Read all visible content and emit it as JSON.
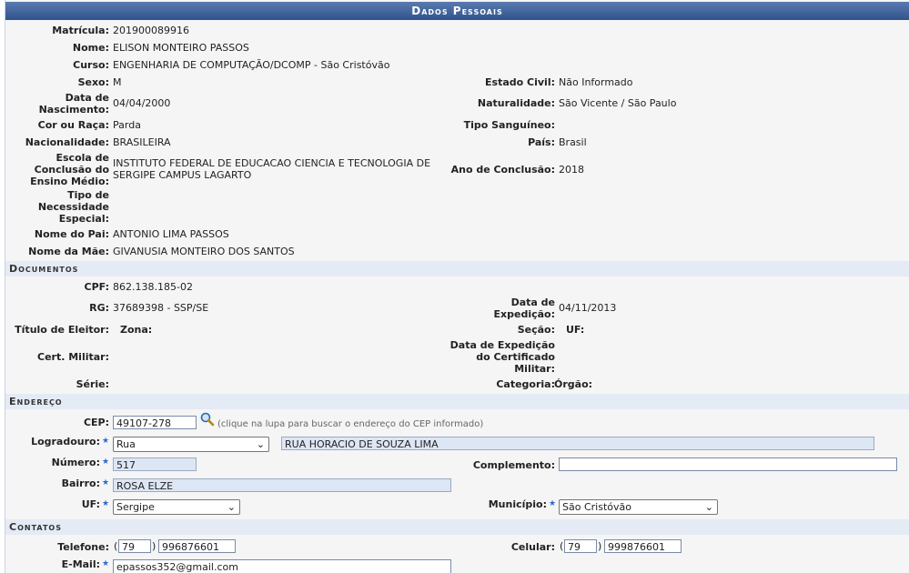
{
  "caption": "Dados Pessoais",
  "personal": {
    "matricula_label": "Matrícula:",
    "matricula": "201900089916",
    "nome_label": "Nome:",
    "nome": "ELISON MONTEIRO PASSOS",
    "curso_label": "Curso:",
    "curso": "ENGENHARIA DE COMPUTAÇÃO/DCOMP - São Cristóvão",
    "sexo_label": "Sexo:",
    "sexo": "M",
    "estado_civil_label": "Estado Civil:",
    "estado_civil": "Não Informado",
    "nascimento_label_1": "Data de",
    "nascimento_label_2": "Nascimento:",
    "nascimento": "04/04/2000",
    "naturalidade_label": "Naturalidade:",
    "naturalidade": "São Vicente / São Paulo",
    "cor_label": "Cor ou Raça:",
    "cor": "Parda",
    "sangue_label": "Tipo Sanguíneo:",
    "nacionalidade_label": "Nacionalidade:",
    "nacionalidade": "BRASILEIRA",
    "pais_label": "País:",
    "pais": "Brasil",
    "escola_label_1": "Escola de",
    "escola_label_2": "Conclusão do",
    "escola_label_3": "Ensino Médio:",
    "escola": "INSTITUTO FEDERAL DE EDUCACAO CIENCIA E TECNOLOGIA DE SERGIPE CAMPUS LAGARTO",
    "ano_conclusao_label": "Ano de Conclusão:",
    "ano_conclusao": "2018",
    "necessidade_label_1": "Tipo de",
    "necessidade_label_2": "Necessidade",
    "necessidade_label_3": "Especial:",
    "pai_label": "Nome do Pai:",
    "pai": "ANTONIO LIMA PASSOS",
    "mae_label": "Nome da Mãe:",
    "mae": "GIVANUSIA MONTEIRO DOS SANTOS"
  },
  "documentos": {
    "title": "Documentos",
    "cpf_label": "CPF:",
    "cpf": "862.138.185-02",
    "rg_label": "RG:",
    "rg": "37689398 - SSP/SE",
    "expedicao_label_1": "Data de",
    "expedicao_label_2": "Expedição:",
    "expedicao": "04/11/2013",
    "titulo_label": "Título de Eleitor:",
    "zona_label": "Zona:",
    "secao_label": "Seção:",
    "uf_label": "UF:",
    "militar_label": "Cert. Militar:",
    "exp_militar_label_1": "Data de Expedição",
    "exp_militar_label_2": "do Certificado",
    "exp_militar_label_3": "Militar:",
    "serie_label": "Série:",
    "categoria_label": "Categoria:",
    "orgao_label": "Órgão:"
  },
  "endereco": {
    "title": "Endereço",
    "cep_label": "CEP:",
    "cep": "49107-278",
    "cep_hint": "(clique na lupa para buscar o endereço do CEP informado)",
    "logradouro_label": "Logradouro:",
    "logradouro_tipo": "Rua",
    "logradouro": "RUA HORACIO DE SOUZA LIMA",
    "numero_label": "Número:",
    "numero": "517",
    "complemento_label": "Complemento:",
    "complemento": "",
    "bairro_label": "Bairro:",
    "bairro": "ROSA ELZE",
    "uf_label": "UF:",
    "uf": "Sergipe",
    "municipio_label": "Município:",
    "municipio": "São Cristóvão"
  },
  "contatos": {
    "title": "Contatos",
    "telefone_label": "Telefone:",
    "telefone_ddd": "79",
    "telefone": "996876601",
    "celular_label": "Celular:",
    "celular_ddd": "79",
    "celular": "999876601",
    "email_label": "E-Mail:",
    "email": "epassos352@gmail.com"
  },
  "icons": {
    "required": "star-icon",
    "search": "magnifier-icon",
    "select": "chevron-down-icon"
  },
  "colors": {
    "caption": "#3b5f96",
    "section": "#e4ebf5",
    "readonly_input": "#dde6f4",
    "required_star": "#2a6ad1"
  }
}
